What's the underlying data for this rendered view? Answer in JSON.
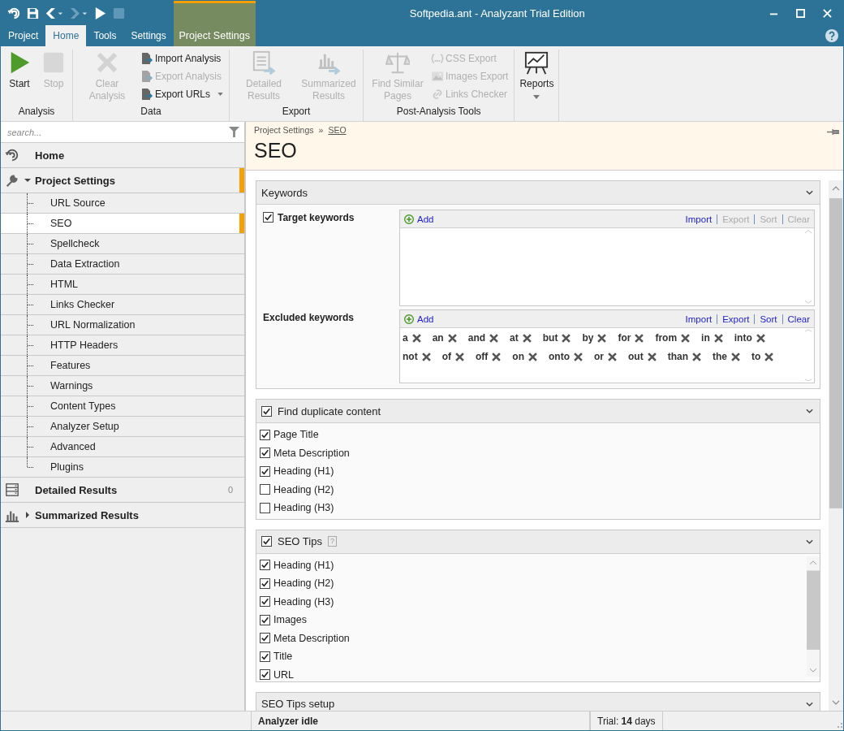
{
  "window": {
    "title": "Softpedia.ant - Analyzant Trial Edition"
  },
  "ribbon_tabs": [
    {
      "label": "Project",
      "selected": false,
      "kind": "normal"
    },
    {
      "label": "Home",
      "selected": true,
      "kind": "normal"
    },
    {
      "label": "Tools",
      "selected": false,
      "kind": "normal"
    },
    {
      "label": "Settings",
      "selected": false,
      "kind": "normal"
    },
    {
      "label": "Project Settings",
      "selected": false,
      "kind": "contextual"
    }
  ],
  "ribbon_groups": [
    {
      "label": "Analysis",
      "items": [
        {
          "label": "Start",
          "kind": "large",
          "disabled": false
        },
        {
          "label": "Stop",
          "kind": "large",
          "disabled": true
        }
      ]
    },
    {
      "label": "Data",
      "items": [
        {
          "label": "Clear Analysis",
          "kind": "large",
          "disabled": true
        },
        {
          "label": "Import Analysis",
          "kind": "small",
          "disabled": false
        },
        {
          "label": "Export Analysis",
          "kind": "small",
          "disabled": true
        },
        {
          "label": "Export URLs",
          "kind": "small",
          "disabled": false,
          "dropdown": true
        }
      ]
    },
    {
      "label": "Export",
      "items": [
        {
          "label": "Detailed Results",
          "kind": "large",
          "disabled": true
        },
        {
          "label": "Summarized Results",
          "kind": "large",
          "disabled": true
        }
      ]
    },
    {
      "label": "Post-Analysis Tools",
      "items": [
        {
          "label": "Find Similar Pages",
          "kind": "large",
          "disabled": true
        },
        {
          "label": "CSS Export",
          "kind": "small",
          "disabled": true
        },
        {
          "label": "Images Export",
          "kind": "small",
          "disabled": true
        },
        {
          "label": "Links Checker",
          "kind": "small",
          "disabled": true
        }
      ]
    },
    {
      "items": [
        {
          "label": "Reports",
          "kind": "large",
          "disabled": false,
          "dropdown": true
        }
      ]
    }
  ],
  "sidebar": {
    "search": {
      "placeholder": "search..."
    },
    "items": [
      {
        "label": "Home",
        "kind": "home",
        "selected": false
      },
      {
        "label": "Project Settings",
        "kind": "settings",
        "selected": true,
        "expanded": true,
        "children": [
          {
            "label": "URL Source",
            "selected": false
          },
          {
            "label": "SEO",
            "selected": true
          },
          {
            "label": "Spellcheck",
            "selected": false
          },
          {
            "label": "Data Extraction",
            "selected": false
          },
          {
            "label": "HTML",
            "selected": false
          },
          {
            "label": "Links Checker",
            "selected": false
          },
          {
            "label": "URL Normalization",
            "selected": false
          },
          {
            "label": "HTTP Headers",
            "selected": false
          },
          {
            "label": "Features",
            "selected": false
          },
          {
            "label": "Warnings",
            "selected": false
          },
          {
            "label": "Content Types",
            "selected": false
          },
          {
            "label": "Analyzer Setup",
            "selected": false
          },
          {
            "label": "Advanced",
            "selected": false
          },
          {
            "label": "Plugins",
            "selected": false
          }
        ]
      },
      {
        "label": "Detailed Results",
        "kind": "results",
        "selected": false,
        "count": "0"
      },
      {
        "label": "Summarized Results",
        "kind": "summary",
        "selected": false,
        "expanded": false
      }
    ]
  },
  "page": {
    "breadcrumb": [
      {
        "label": "Project Settings",
        "link": false
      },
      {
        "label": "SEO",
        "link": true
      }
    ],
    "breadcrumb_separator": "»",
    "title": "SEO"
  },
  "sections": [
    {
      "kind": "keywords",
      "title": "Keywords",
      "lists": [
        {
          "label": "Target keywords",
          "checked": true,
          "add": "Add",
          "actions": [
            {
              "label": "Import",
              "disabled": false
            },
            {
              "label": "Export",
              "disabled": true
            },
            {
              "label": "Sort",
              "disabled": true
            },
            {
              "label": "Clear",
              "disabled": true
            }
          ]
        },
        {
          "label": "Excluded keywords",
          "add": "Add",
          "actions": [
            {
              "label": "Import",
              "disabled": false
            },
            {
              "label": "Export",
              "disabled": false
            },
            {
              "label": "Sort",
              "disabled": false
            },
            {
              "label": "Clear",
              "disabled": false
            }
          ],
          "keywords": [
            "a",
            "an",
            "and",
            "at",
            "but",
            "by",
            "for",
            "from",
            "in",
            "into",
            "not",
            "of",
            "off",
            "on",
            "onto",
            "or",
            "out",
            "than",
            "the",
            "to"
          ]
        }
      ]
    },
    {
      "kind": "checklist",
      "title": "Find duplicate content",
      "checked": true,
      "items": [
        {
          "label": "Page Title",
          "checked": true
        },
        {
          "label": "Meta Description",
          "checked": true
        },
        {
          "label": "Heading (H1)",
          "checked": true
        },
        {
          "label": "Heading (H2)",
          "checked": false
        },
        {
          "label": "Heading (H3)",
          "checked": false
        }
      ]
    },
    {
      "kind": "scroll-checklist",
      "title": "SEO Tips",
      "checked": true,
      "help": "?",
      "items": [
        {
          "label": "Heading (H1)",
          "checked": true
        },
        {
          "label": "Heading (H2)",
          "checked": true
        },
        {
          "label": "Heading (H3)",
          "checked": true
        },
        {
          "label": "Images",
          "checked": true
        },
        {
          "label": "Meta Description",
          "checked": true
        },
        {
          "label": "Title",
          "checked": true
        },
        {
          "label": "URL",
          "checked": true
        }
      ]
    },
    {
      "kind": "header",
      "title": "SEO Tips setup"
    }
  ],
  "status_bar": [
    {
      "text": "Analyzer idle"
    },
    {
      "text": "Trial: **14** days"
    }
  ]
}
